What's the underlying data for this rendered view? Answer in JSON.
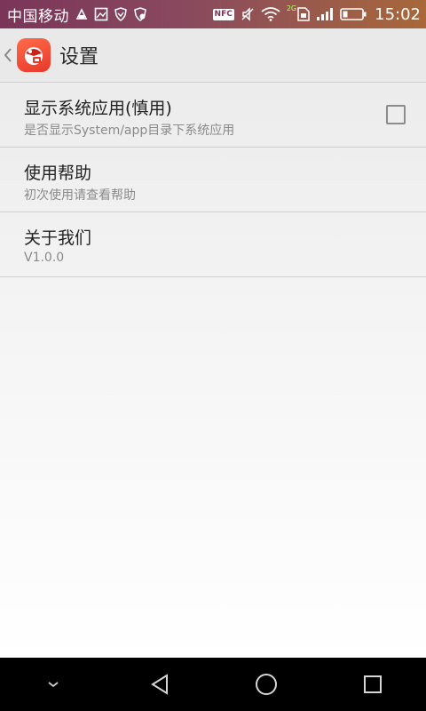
{
  "status_bar": {
    "carrier": "中国移动",
    "nfc_label": "NFC",
    "network_label": "2G",
    "time": "15:02",
    "icons": [
      "notification-icon",
      "image-icon",
      "shield-icon",
      "security-icon",
      "nfc-icon",
      "mute-icon",
      "wifi-icon",
      "sim-icon",
      "signal-icon",
      "battery-icon"
    ]
  },
  "action_bar": {
    "title": "设置"
  },
  "settings": {
    "items": [
      {
        "title": "显示系统应用(慎用)",
        "summary": "是否显示System/app目录下系统应用",
        "checked": false
      },
      {
        "title": "使用帮助",
        "summary": "初次使用请查看帮助"
      },
      {
        "title": "关于我们",
        "summary": "V1.0.0"
      }
    ]
  },
  "colors": {
    "status_bar_start": "#7a3559",
    "status_bar_end": "#a8683a",
    "action_bar": "#e9e9e9",
    "app_icon": "#e8382a",
    "nav_bar": "#000000"
  }
}
